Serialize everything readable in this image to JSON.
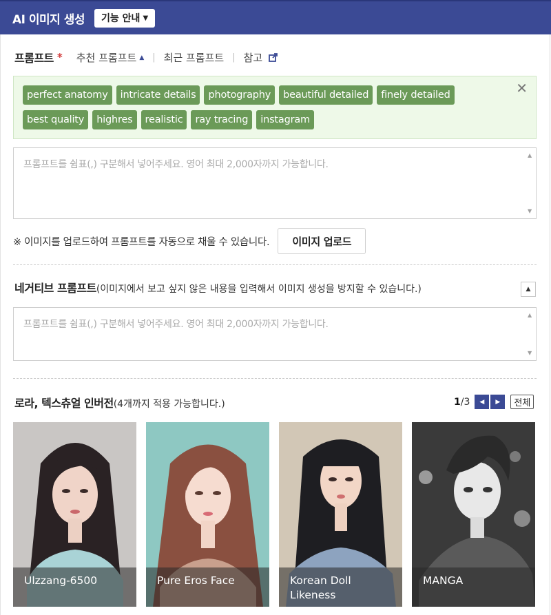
{
  "header": {
    "title": "AI 이미지 생성",
    "guide_label": "기능 안내"
  },
  "prompt": {
    "label": "프롬프트",
    "required_mark": "*",
    "tab_recommended": "추천 프롬프트",
    "tab_recent": "최근 프롬프트",
    "tab_reference": "참고",
    "tags": [
      "perfect anatomy",
      "intricate details",
      "photography",
      "beautiful detailed",
      "finely detailed",
      "best quality",
      "highres",
      "realistic",
      "ray tracing",
      "instagram"
    ],
    "placeholder": "프롬프트를 쉼표(,) 구분해서 넣어주세요. 영어 최대 2,000자까지 가능합니다."
  },
  "upload": {
    "note": "※ 이미지를 업로드하여 프롬프트를 자동으로 채울 수 있습니다.",
    "button": "이미지 업로드"
  },
  "negative": {
    "title": "네거티브 프롬프트",
    "desc": "(이미지에서 보고 싶지 않은 내용을 입력해서 이미지 생성을 방지할 수 있습니다.)",
    "placeholder": "프롬프트를 쉼표(,) 구분해서 넣어주세요. 영어 최대 2,000자까지 가능합니다."
  },
  "lora": {
    "title": "로라, 텍스츄얼 인버전",
    "desc": "(4개까지 적용 가능합니다.)",
    "page_current": "1",
    "page_total": "/3",
    "all_label": "전체",
    "cards": [
      {
        "name": "Ulzzang-6500"
      },
      {
        "name": "Pure Eros Face"
      },
      {
        "name": "Korean Doll Likeness"
      },
      {
        "name": "MANGA"
      }
    ]
  },
  "colors": {
    "header_bg": "#3b4a95",
    "tag_bg": "#6b9a58",
    "tag_box_bg": "#eef9e8",
    "required": "#d23a3a"
  }
}
